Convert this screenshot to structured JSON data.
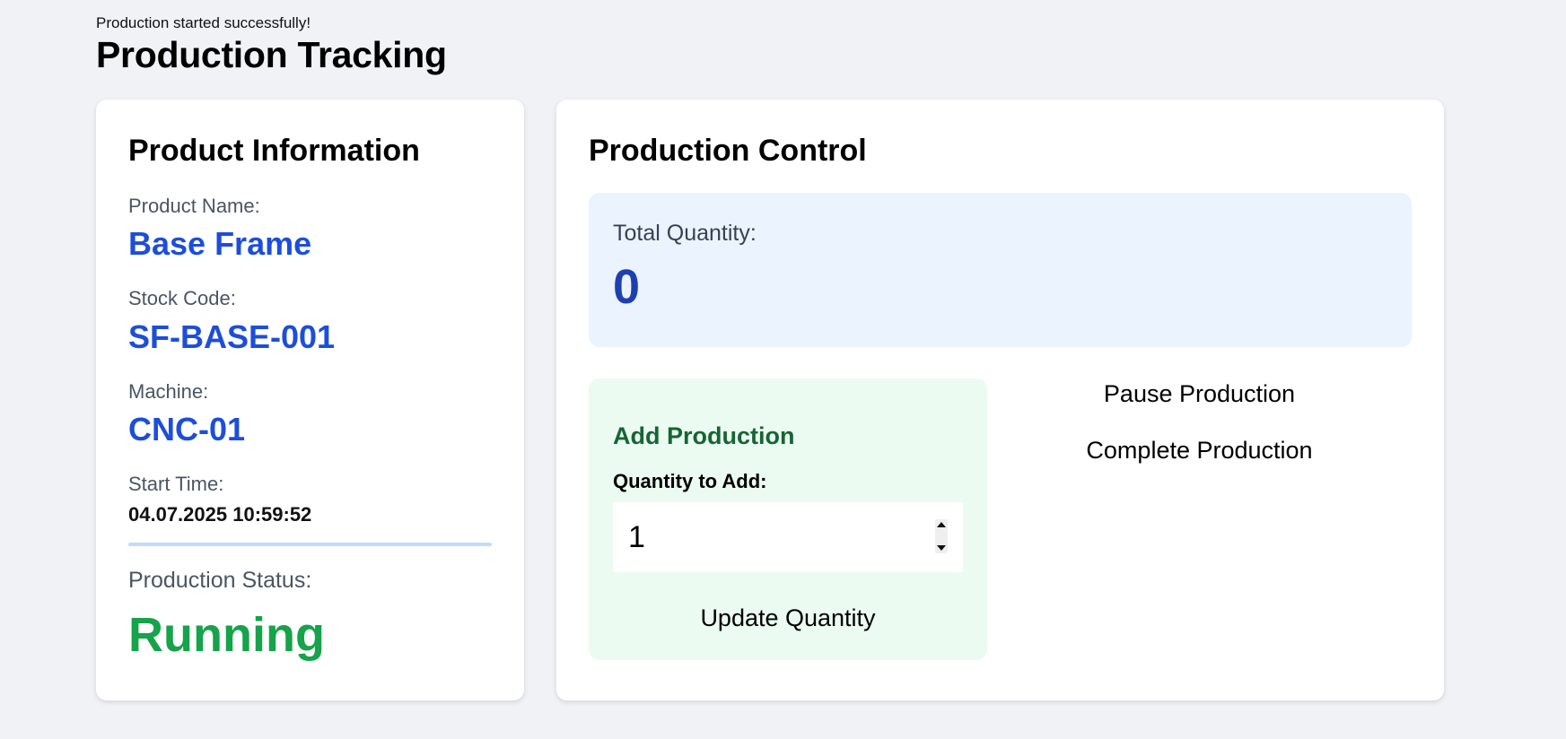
{
  "flash_message": "Production started successfully!",
  "page_title": "Production Tracking",
  "product_info": {
    "title": "Product Information",
    "product_name_label": "Product Name:",
    "product_name": "Base Frame",
    "stock_code_label": "Stock Code:",
    "stock_code": "SF-BASE-001",
    "machine_label": "Machine:",
    "machine": "CNC-01",
    "start_time_label": "Start Time:",
    "start_time": "04.07.2025 10:59:52",
    "status_label": "Production Status:",
    "status": "Running"
  },
  "production_control": {
    "title": "Production Control",
    "total_quantity_label": "Total Quantity:",
    "total_quantity": "0",
    "add_production": {
      "title": "Add Production",
      "quantity_label": "Quantity to Add:",
      "quantity_value": "1",
      "update_button": "Update Quantity"
    },
    "pause_button": "Pause Production",
    "complete_button": "Complete Production"
  },
  "colors": {
    "accent_blue": "#1d4ed8",
    "status_green": "#16a34a",
    "add_title_green": "#166534"
  }
}
